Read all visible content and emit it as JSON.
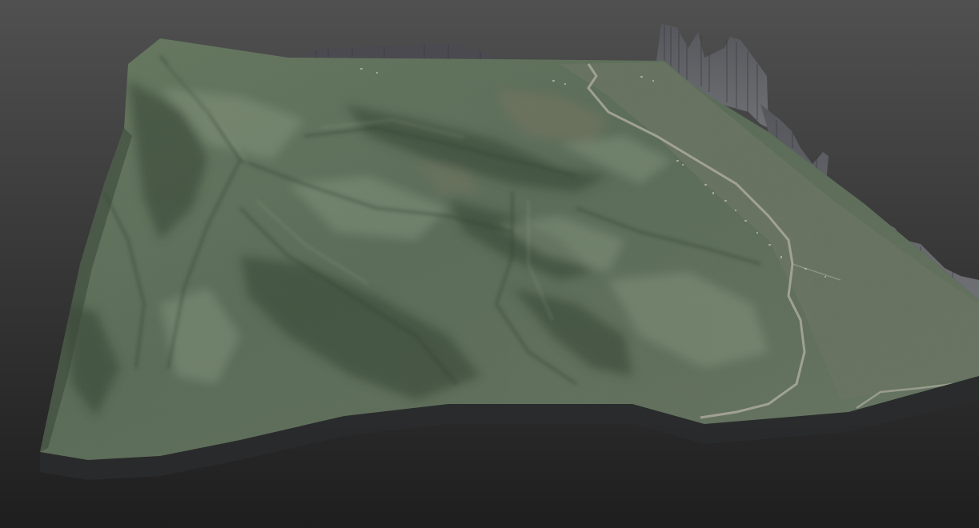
{
  "viewport": {
    "background_top": "#505050",
    "background_bottom": "#1e1e1e"
  },
  "terrain": {
    "texture_colors": {
      "vegetation_base": "#5a6b58",
      "vegetation_dark": "#3a4838",
      "vegetation_light": "#7a8c74",
      "bare_ground": "#7d7a62",
      "road": "#b0aea0",
      "edge_wall": "#6a6a6e",
      "edge_wall_dark": "#3e3e44",
      "base_side": "#2a2b2c"
    }
  }
}
